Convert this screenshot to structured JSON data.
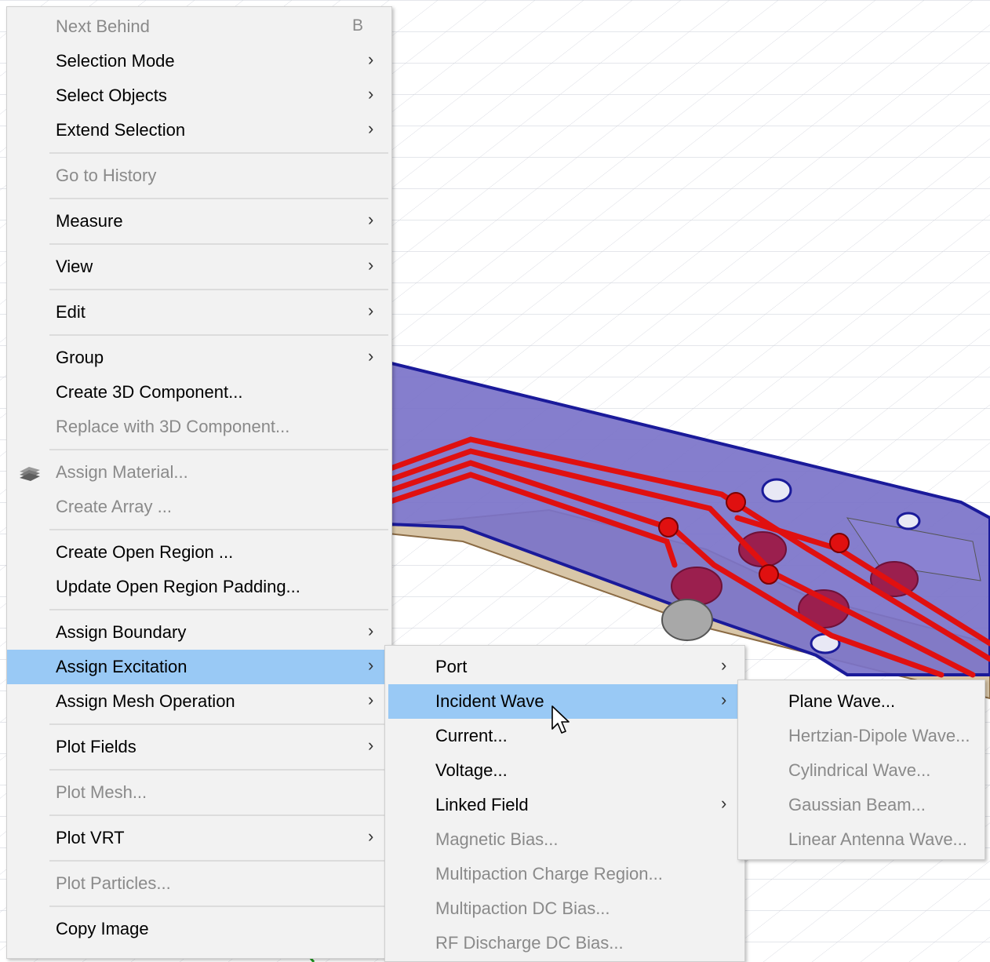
{
  "main_menu": {
    "items": [
      {
        "label": "Next Behind",
        "shortcut": "B",
        "enabled": false
      },
      {
        "label": "Selection Mode",
        "submenu": true,
        "enabled": true
      },
      {
        "label": "Select Objects",
        "submenu": true,
        "enabled": true
      },
      {
        "label": "Extend Selection",
        "submenu": true,
        "enabled": true
      },
      {
        "label": "Go to History",
        "enabled": false
      },
      {
        "label": "Measure",
        "submenu": true,
        "enabled": true
      },
      {
        "label": "View",
        "submenu": true,
        "enabled": true
      },
      {
        "label": "Edit",
        "submenu": true,
        "enabled": true
      },
      {
        "label": "Group",
        "submenu": true,
        "enabled": true
      },
      {
        "label": "Create 3D Component...",
        "enabled": true
      },
      {
        "label": "Replace with 3D Component...",
        "enabled": false
      },
      {
        "label": "Assign Material...",
        "enabled": false,
        "icon": "material-icon"
      },
      {
        "label": "Create Array ...",
        "enabled": false
      },
      {
        "label": "Create Open Region ...",
        "enabled": true
      },
      {
        "label": "Update Open Region Padding...",
        "enabled": true
      },
      {
        "label": "Assign Boundary",
        "submenu": true,
        "enabled": true
      },
      {
        "label": "Assign Excitation",
        "submenu": true,
        "enabled": true,
        "highlighted": true
      },
      {
        "label": "Assign Mesh Operation",
        "submenu": true,
        "enabled": true
      },
      {
        "label": "Plot Fields",
        "submenu": true,
        "enabled": true
      },
      {
        "label": "Plot Mesh...",
        "enabled": false
      },
      {
        "label": "Plot VRT",
        "submenu": true,
        "enabled": true
      },
      {
        "label": "Plot Particles...",
        "enabled": false
      },
      {
        "label": "Copy Image",
        "enabled": true
      }
    ]
  },
  "excitation_menu": {
    "items": [
      {
        "label": "Port",
        "submenu": true,
        "enabled": true
      },
      {
        "label": "Incident Wave",
        "submenu": true,
        "enabled": true,
        "highlighted": true
      },
      {
        "label": "Current...",
        "enabled": true
      },
      {
        "label": "Voltage...",
        "enabled": true
      },
      {
        "label": "Linked Field",
        "submenu": true,
        "enabled": true
      },
      {
        "label": "Magnetic Bias...",
        "enabled": false
      },
      {
        "label": "Multipaction Charge Region...",
        "enabled": false
      },
      {
        "label": "Multipaction DC Bias...",
        "enabled": false
      },
      {
        "label": "RF Discharge DC Bias...",
        "enabled": false
      }
    ]
  },
  "incident_wave_menu": {
    "items": [
      {
        "label": "Plane Wave...",
        "enabled": true
      },
      {
        "label": "Hertzian-Dipole Wave...",
        "enabled": false
      },
      {
        "label": "Cylindrical Wave...",
        "enabled": false
      },
      {
        "label": "Gaussian Beam...",
        "enabled": false
      },
      {
        "label": "Linear Antenna Wave...",
        "enabled": false
      }
    ]
  },
  "submenu_arrow": "›",
  "colors": {
    "highlight": "#99c9f5",
    "board": "#7b73c9",
    "trace": "#e01010",
    "via": "#9b1f4e"
  }
}
